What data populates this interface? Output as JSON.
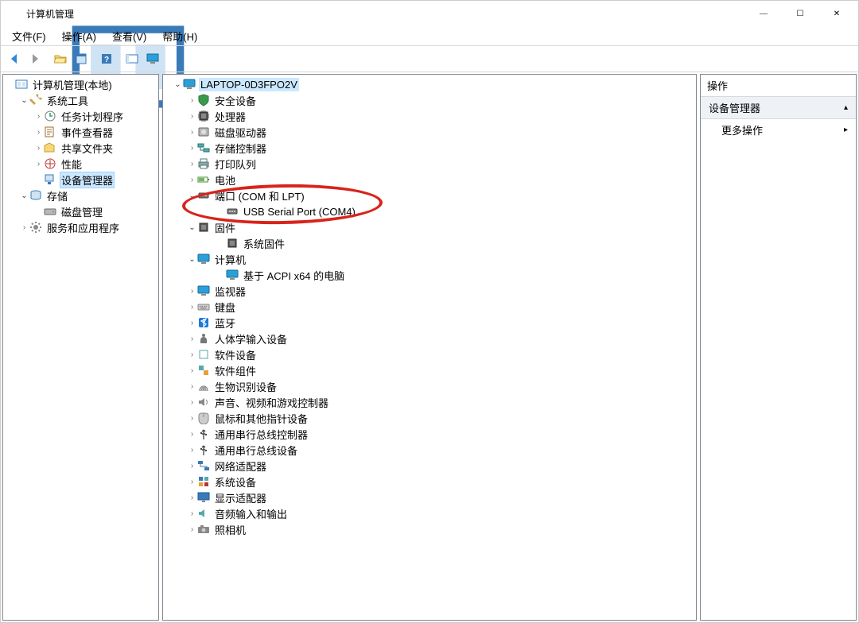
{
  "window": {
    "title": "计算机管理"
  },
  "menubar": [
    "文件(F)",
    "操作(A)",
    "查看(V)",
    "帮助(H)"
  ],
  "left_tree": {
    "root": "计算机管理(本地)",
    "system_tools": {
      "label": "系统工具",
      "children": [
        "任务计划程序",
        "事件查看器",
        "共享文件夹",
        "性能",
        "设备管理器"
      ]
    },
    "storage": {
      "label": "存储",
      "children": [
        "磁盘管理"
      ]
    },
    "services": {
      "label": "服务和应用程序"
    },
    "selected": "设备管理器"
  },
  "center_tree": {
    "root": "LAPTOP-0D3FPO2V",
    "items": [
      {
        "label": "安全设备",
        "icon": "shield"
      },
      {
        "label": "处理器",
        "icon": "cpu"
      },
      {
        "label": "磁盘驱动器",
        "icon": "disk"
      },
      {
        "label": "存储控制器",
        "icon": "storagectl"
      },
      {
        "label": "打印队列",
        "icon": "printer"
      },
      {
        "label": "电池",
        "icon": "battery"
      }
    ],
    "ports": {
      "label": "端口 (COM 和 LPT)",
      "children": [
        {
          "label": "USB Serial Port (COM4)",
          "icon": "port"
        }
      ]
    },
    "firmware": {
      "label": "固件",
      "children": [
        {
          "label": "系统固件",
          "icon": "chip"
        }
      ]
    },
    "computers": {
      "label": "计算机",
      "children": [
        {
          "label": "基于 ACPI x64 的电脑",
          "icon": "monitor"
        }
      ]
    },
    "rest": [
      {
        "label": "监视器",
        "icon": "monitor"
      },
      {
        "label": "键盘",
        "icon": "keyboard"
      },
      {
        "label": "蓝牙",
        "icon": "bluetooth"
      },
      {
        "label": "人体学输入设备",
        "icon": "hid"
      },
      {
        "label": "软件设备",
        "icon": "softdev"
      },
      {
        "label": "软件组件",
        "icon": "softcomp"
      },
      {
        "label": "生物识别设备",
        "icon": "biometric"
      },
      {
        "label": "声音、视频和游戏控制器",
        "icon": "sound"
      },
      {
        "label": "鼠标和其他指针设备",
        "icon": "mouse"
      },
      {
        "label": "通用串行总线控制器",
        "icon": "usb"
      },
      {
        "label": "通用串行总线设备",
        "icon": "usb"
      },
      {
        "label": "网络适配器",
        "icon": "network"
      },
      {
        "label": "系统设备",
        "icon": "sysdev"
      },
      {
        "label": "显示适配器",
        "icon": "display"
      },
      {
        "label": "音频输入和输出",
        "icon": "audio"
      },
      {
        "label": "照相机",
        "icon": "camera"
      }
    ]
  },
  "right": {
    "header": "操作",
    "section": "设备管理器",
    "action": "更多操作"
  }
}
